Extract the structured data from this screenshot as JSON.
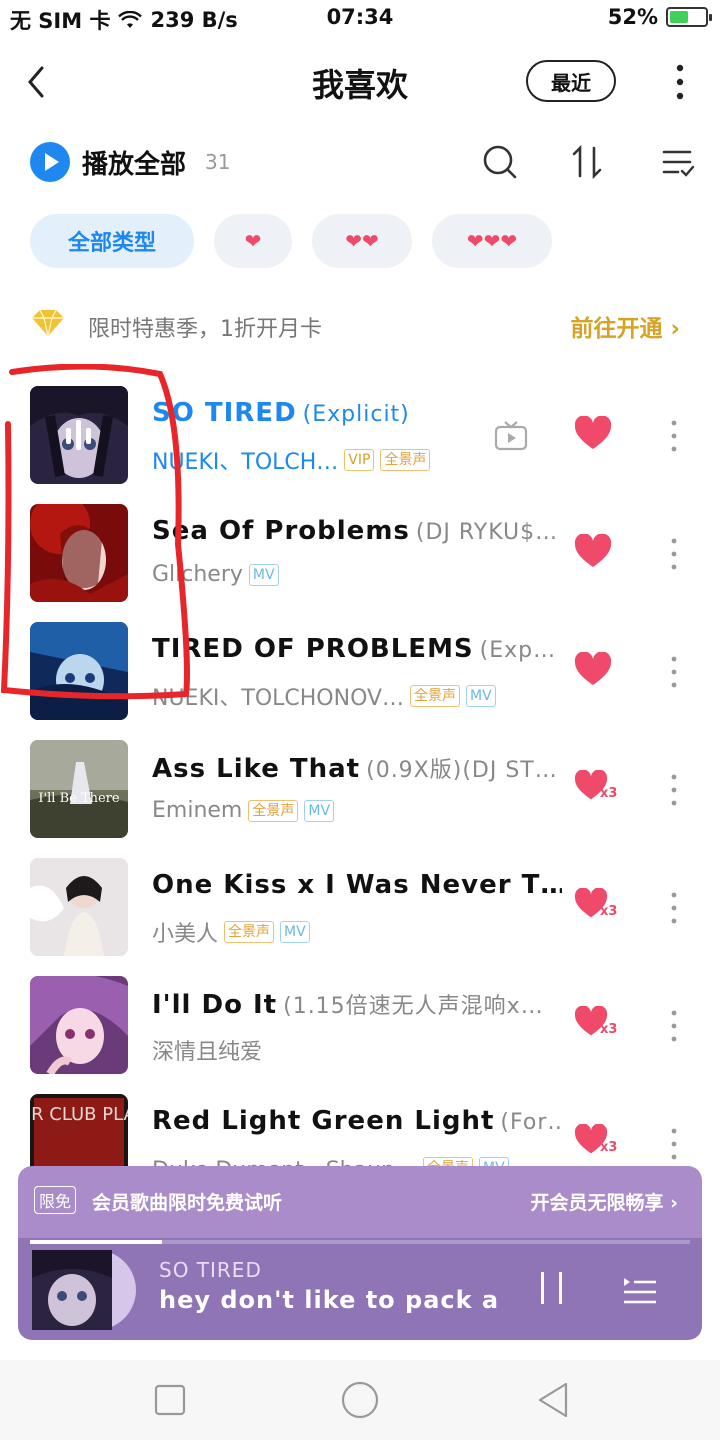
{
  "status_bar": {
    "carrier": "无 SIM 卡",
    "net_speed": "239 B/s",
    "time": "07:34",
    "battery": "52%",
    "battery_level": 0.52
  },
  "header": {
    "title": "我喜欢",
    "recent_button": "最近"
  },
  "play_bar": {
    "play_all_label": "播放全部",
    "count": "31"
  },
  "filter_chips": [
    {
      "label": "全部类型",
      "active": true
    },
    {
      "label": "❤",
      "active": false
    },
    {
      "label": "❤❤",
      "active": false
    },
    {
      "label": "❤❤❤",
      "active": false
    }
  ],
  "promo": {
    "text": "限时特惠季，1折开月卡",
    "link": "前往开通"
  },
  "songs": [
    {
      "title": "SO TIRED",
      "subtitle": "(Explicit)",
      "artist": "NUEKI、TOLCH…",
      "tags": [
        "VIP",
        "全景声"
      ],
      "playing": true,
      "has_tv": true,
      "like": "1"
    },
    {
      "title": "Sea Of Problems",
      "subtitle": "(DJ RYKU$…",
      "artist": "Glichery",
      "tags": [
        "MV"
      ],
      "playing": false,
      "has_tv": false,
      "like": "1"
    },
    {
      "title": "TIRED OF PROBLEMS",
      "subtitle": "(Exp…",
      "artist": "NUEKI、TOLCHONOV…",
      "tags": [
        "全景声",
        "MV"
      ],
      "playing": false,
      "has_tv": false,
      "like": "1"
    },
    {
      "title": "Ass Like That",
      "subtitle": "(0.9X版)(DJ ST…",
      "artist": "Eminem",
      "tags": [
        "全景声",
        "MV"
      ],
      "playing": false,
      "has_tv": false,
      "like": "x3"
    },
    {
      "title": "One Kiss x I Was Never T…",
      "subtitle": "",
      "artist": "小美人",
      "tags": [
        "全景声",
        "MV"
      ],
      "playing": false,
      "has_tv": false,
      "like": "x3"
    },
    {
      "title": "I'll Do It",
      "subtitle": "(1.15倍速无人声混响x…",
      "artist": "深情且纯爱",
      "tags": [],
      "playing": false,
      "has_tv": false,
      "like": "x3"
    },
    {
      "title": "Red Light Green Light",
      "subtitle": "(For…",
      "artist": "Duke Dumont、Shaun…",
      "tags": [
        "全景声",
        "MV"
      ],
      "playing": false,
      "has_tv": false,
      "like": "x3"
    }
  ],
  "cover_text": {
    "song4": "I'll Be There",
    "song7": "FOR CLUB PLAY"
  },
  "vip_banner": {
    "badge": "限免",
    "text": "会员歌曲限时免费试听",
    "link": "开会员无限畅享"
  },
  "mini_player": {
    "track": "SO TIRED",
    "lyric": "hey don't like to pack a t",
    "progress": 0.2
  },
  "colors": {
    "accent": "#1e88f0",
    "heart": "#f04a6a",
    "gold": "#d5a427",
    "player_bg": "#8f74b6"
  }
}
